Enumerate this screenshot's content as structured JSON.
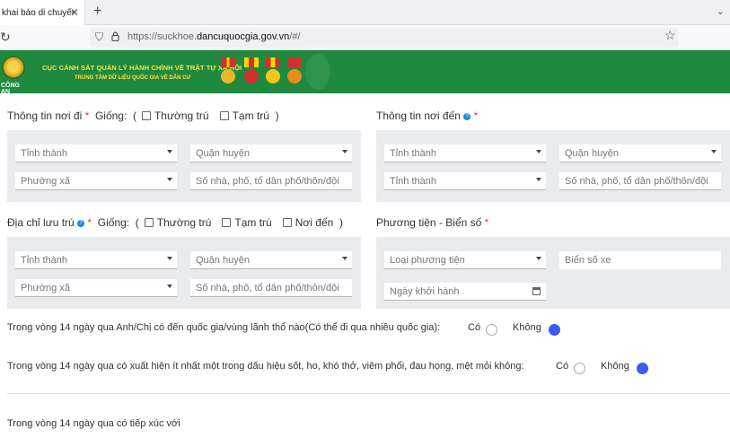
{
  "browser": {
    "tab_title": "khai báo di chuyển nội",
    "tab_close": "✕",
    "new_tab": "+",
    "url_domain_prefix": "https://suckhoe.",
    "url_domain": "dancuquocgia.gov.vn",
    "url_path": "/#/"
  },
  "banner": {
    "title_line1": "CỤC CẢNH SÁT QUẢN LÝ HÀNH CHÍNH VỀ TRẬT TỰ XÃ HỘI",
    "title_line2": "TRUNG TÂM DỮ LIỆU QUỐC GIA VỀ DÂN CƯ",
    "emblem_label": "CÔNG AN"
  },
  "origin": {
    "title": "Thông tin nơi đi",
    "same_label": "Giống:",
    "open_paren": "(",
    "close_paren": ")",
    "opt_permanent": "Thường trú",
    "opt_temporary": "Tạm trú",
    "province": "Tỉnh thành",
    "district": "Quận huyện",
    "ward": "Phường xã",
    "address": "Số nhà, phố, tổ dân phố/thôn/đội"
  },
  "destination": {
    "title": "Thông tin nơi đến",
    "province": "Tỉnh thành",
    "district": "Quận huyện",
    "province2": "Tỉnh thành",
    "address": "Số nhà, phố, tổ dân phố/thôn/đội"
  },
  "residence": {
    "title": "Địa chỉ lưu trú",
    "same_label": "Giống:",
    "open_paren": "(",
    "close_paren": ")",
    "opt_permanent": "Thường trú",
    "opt_temporary": "Tạm trú",
    "opt_destination": "Nơi đến",
    "province": "Tỉnh thành",
    "district": "Quận huyện",
    "ward": "Phường xã",
    "address": "Số nhà, phố, tổ dân phố/thôn/đội"
  },
  "vehicle": {
    "title": "Phương tiện - Biển số",
    "type": "Loại phương tiện",
    "plate": "Biển số xe",
    "date": "Ngày khởi hành"
  },
  "q1": {
    "text": "Trong vòng 14 ngày qua Anh/Chị có đến quốc gia/vùng lãnh thổ nào(Có thể đi qua nhiều quốc gia):",
    "yes": "Có",
    "no": "Không",
    "selected": "no"
  },
  "q2": {
    "text": "Trong vòng 14 ngày qua có xuất hiện ít nhất một trong dấu hiệu sốt, ho, khó thở, viêm phổi, đau họng, mệt mỏi không:",
    "yes": "Có",
    "no": "Không",
    "selected": "no"
  },
  "q3": {
    "text": "Trong vòng 14 ngày qua có tiếp xúc với"
  },
  "colors": {
    "banner_green": "#1f8a3f",
    "banner_text": "#ffe14a",
    "radio_selected": "#3d5af1",
    "required": "#e53935"
  }
}
